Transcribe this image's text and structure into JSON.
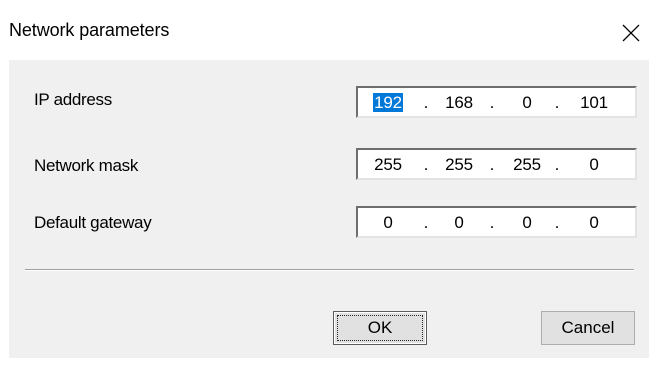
{
  "dialog": {
    "title": "Network parameters"
  },
  "fields": [
    {
      "label": "IP address",
      "octets": [
        "192",
        "168",
        "0",
        "101"
      ],
      "selected_octet": 0
    },
    {
      "label": "Network mask",
      "octets": [
        "255",
        "255",
        "255",
        "0"
      ]
    },
    {
      "label": "Default gateway",
      "octets": [
        "0",
        "0",
        "0",
        "0"
      ]
    }
  ],
  "separator_char": ".",
  "buttons": {
    "ok_label": "OK",
    "cancel_label": "Cancel"
  },
  "colors": {
    "client_bg": "#f0f0f0",
    "selection": "#0078d7"
  }
}
